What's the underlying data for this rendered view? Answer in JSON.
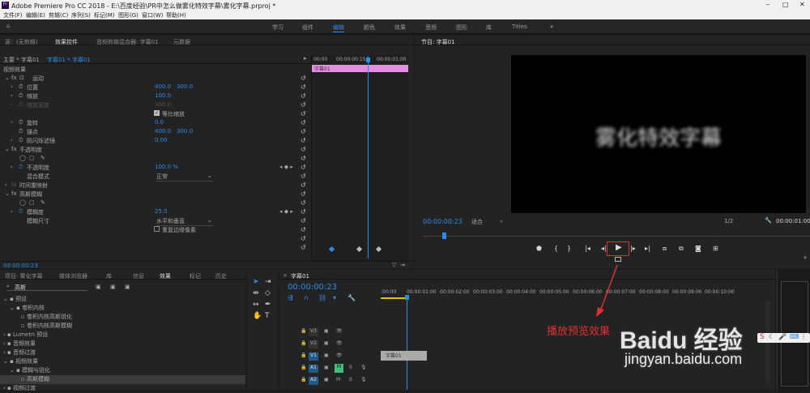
{
  "app": {
    "title": "Adobe Premiere Pro CC 2018 - E:\\百度经验\\PR中怎么做雾化特效字幕\\雾化字幕.prproj *",
    "menus": [
      "文件(F)",
      "编辑(E)",
      "剪辑(C)",
      "序列(S)",
      "标记(M)",
      "图形(G)",
      "窗口(W)",
      "帮助(H)"
    ]
  },
  "workspaces": [
    "学习",
    "组件",
    "编辑",
    "颜色",
    "效果",
    "音频",
    "图形",
    "库",
    "Titles"
  ],
  "left_tabs": [
    "源：(无剪辑)",
    "效果控件",
    "音频剪辑混合器: 字幕01",
    "元数据"
  ],
  "ec": {
    "master": "主要 * 字幕01",
    "seq": "字幕01 * 字幕01",
    "section": "视频效果",
    "fx_motion": "运动",
    "position": "位置",
    "pos_x": "400.0",
    "pos_y": "300.0",
    "scale": "缩放",
    "scale_v": "100.0",
    "scale_w": "缩放宽度",
    "scale_w_v": "100.0",
    "uniform": "等比缩放",
    "rotation": "旋转",
    "rot_v": "0.0",
    "anchor": "锚点",
    "anc_x": "400.0",
    "anc_y": "300.0",
    "flicker": "防闪烁滤镜",
    "flicker_v": "0.00",
    "opacity": "不透明度",
    "opacity_prop": "不透明度",
    "opacity_v": "100.0 %",
    "blend": "混合模式",
    "blend_v": "正常",
    "remap": "时间重映射",
    "blur": "高斯模糊",
    "blur_amt": "模糊度",
    "blur_v": "25.0",
    "blur_dim": "模糊尺寸",
    "blur_dim_v": "水平和垂直",
    "repeat": "重复边缘像素",
    "t0": "00:00",
    "t15": "00:00:00:15",
    "t1": "00:00:01:00",
    "clip": "字幕01",
    "time": "00:00:00:23"
  },
  "program": {
    "title": "节目: 字幕01",
    "text": "雾化特效字幕",
    "time": "00:00:00:23",
    "fit": "适合",
    "scale": "1/2",
    "end": "00:00:01:00"
  },
  "project_tabs": [
    "项目: 雾化字幕",
    "媒体浏览器",
    "库",
    "信息",
    "效果",
    "标记",
    "历史"
  ],
  "effects": {
    "search": "高斯",
    "items": [
      "预设",
      "卷积内核",
      "卷积内核高斯锐化",
      "卷积内核高斯模糊",
      "Lumetri 预设",
      "音频效果",
      "音频过渡",
      "视频效果",
      "模糊与锐化",
      "高斯模糊",
      "视频过渡"
    ]
  },
  "timeline": {
    "title": "字幕01",
    "time": "00:00:00:23",
    "ruler": [
      ":00:00",
      "00:00:01:00",
      "00:00:02:00",
      "00:00:03:00",
      "00:00:04:00",
      "00:00:05:00",
      "00:00:06:00",
      "00:00:07:00",
      "00:00:08:00",
      "00:00:09:00",
      "00:00:10:00"
    ],
    "tracks": [
      "V3",
      "V2",
      "V1",
      "A1",
      "A2"
    ],
    "clip": "字幕01"
  },
  "annotation": "播放预览效果",
  "watermark": {
    "logo": "Baidu 经验",
    "url": "jingyan.baidu.com"
  },
  "colors": {
    "accent": "#2d8ceb",
    "clip": "#e58de0",
    "annot": "#e03131"
  }
}
